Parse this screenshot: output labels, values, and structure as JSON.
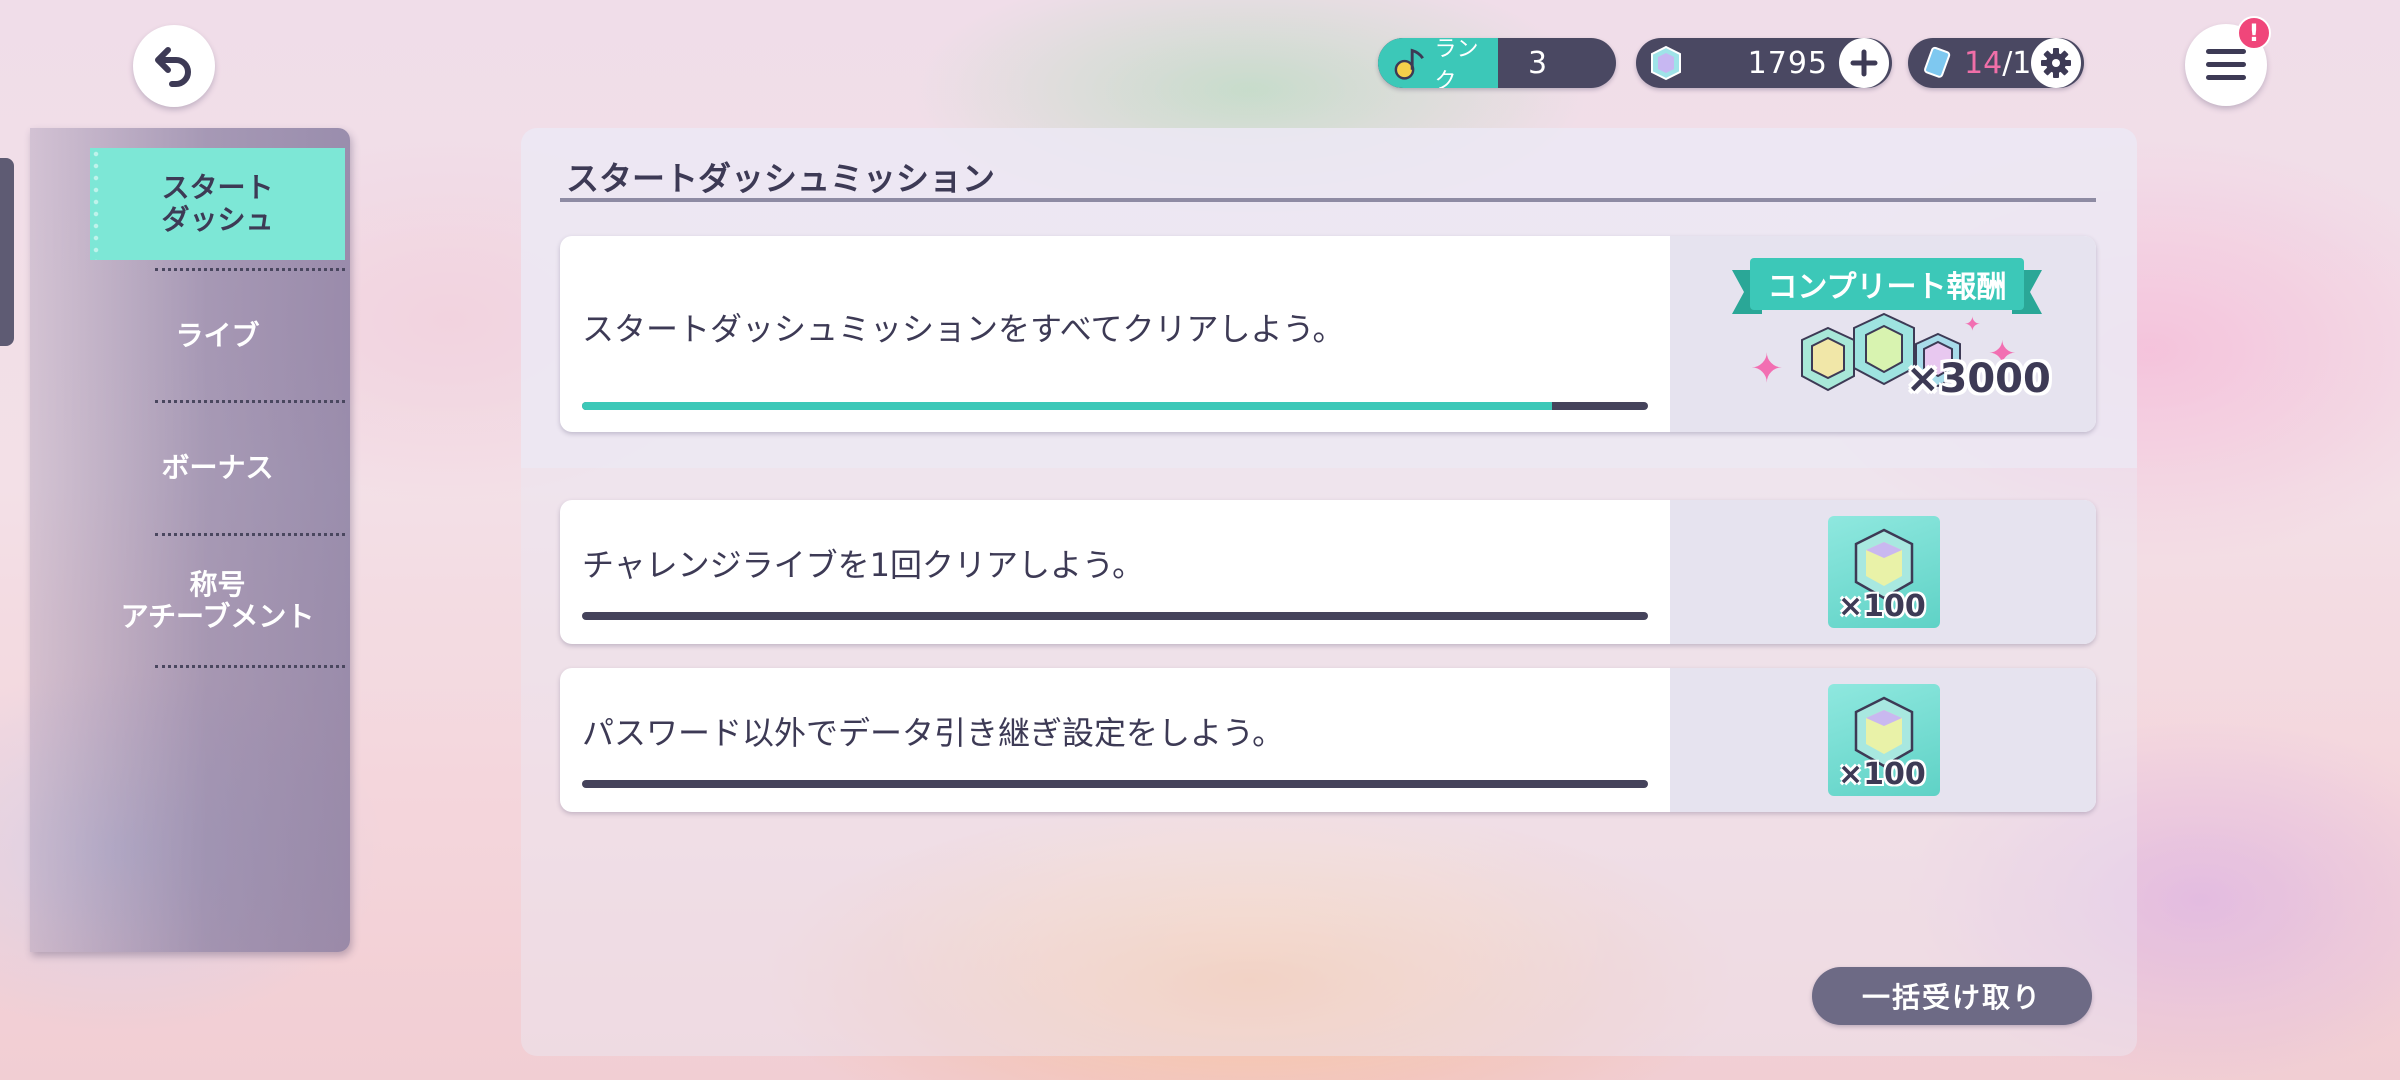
{
  "topbar": {
    "rank_label": "ランク",
    "rank_value": "3",
    "gems": "1795",
    "stamina_current": "14",
    "stamina_max": "/10",
    "menu_badge": "!"
  },
  "sidebar": {
    "items": [
      {
        "label_line1": "スタート",
        "label_line2": "ダッシュ"
      },
      {
        "label_line1": "ライブ"
      },
      {
        "label_line1": "ボーナス"
      },
      {
        "label_line1": "称号",
        "label_line2": "アチーブメント"
      }
    ]
  },
  "panel": {
    "title": "スタートダッシュミッション"
  },
  "complete_mission": {
    "text": "スタートダッシュミッションをすべてクリアしよう。",
    "progress": 0.91,
    "banner": "コンプリート報酬",
    "reward_count": "×3000"
  },
  "missions": [
    {
      "text": "チャレンジライブを1回クリアしよう。",
      "progress": 0.0,
      "reward_count": "×100"
    },
    {
      "text": "パスワード以外でデータ引き継ぎ設定をしよう。",
      "progress": 0.0,
      "reward_count": "×100"
    }
  ],
  "bulk_receive_label": "一括受け取り",
  "colors": {
    "accent": "#3cc8b8",
    "active_tab": "#7de7d6",
    "dark": "#45435b",
    "badge": "#f0467a"
  }
}
